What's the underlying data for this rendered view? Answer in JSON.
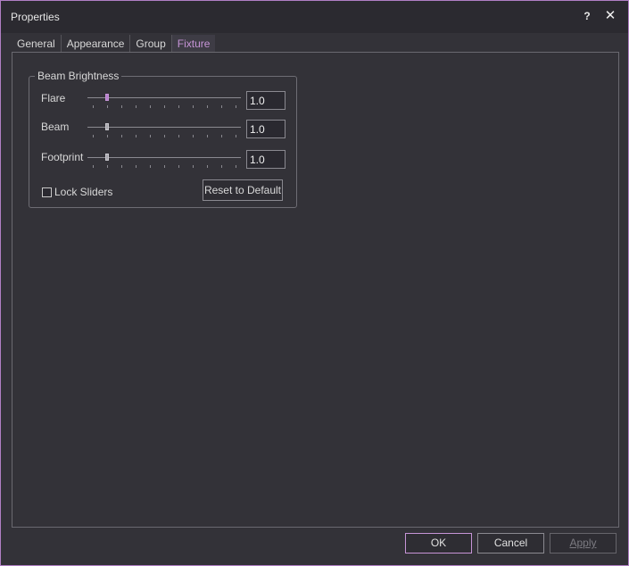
{
  "window": {
    "title": "Properties",
    "help_label": "?",
    "close_label": "✕"
  },
  "tabs": [
    {
      "label": "General",
      "active": false
    },
    {
      "label": "Appearance",
      "active": false
    },
    {
      "label": "Group",
      "active": false
    },
    {
      "label": "Fixture",
      "active": true
    }
  ],
  "beam_brightness": {
    "legend": "Beam Brightness",
    "rows": [
      {
        "label": "Flare",
        "value": "1.0",
        "slider_level": 0.1,
        "highlighted": true
      },
      {
        "label": "Beam",
        "value": "1.0",
        "slider_level": 0.1,
        "highlighted": false
      },
      {
        "label": "Footprint",
        "value": "1.0",
        "slider_level": 0.1,
        "highlighted": false
      }
    ],
    "lock_sliders_label": "Lock Sliders",
    "lock_sliders_checked": false,
    "reset_label": "Reset to Default"
  },
  "footer": {
    "ok_label": "OK",
    "cancel_label": "Cancel",
    "apply_label": "Apply"
  },
  "colors": {
    "accent": "#c694d6",
    "background": "#333238",
    "titlebar": "#2b2a30"
  }
}
